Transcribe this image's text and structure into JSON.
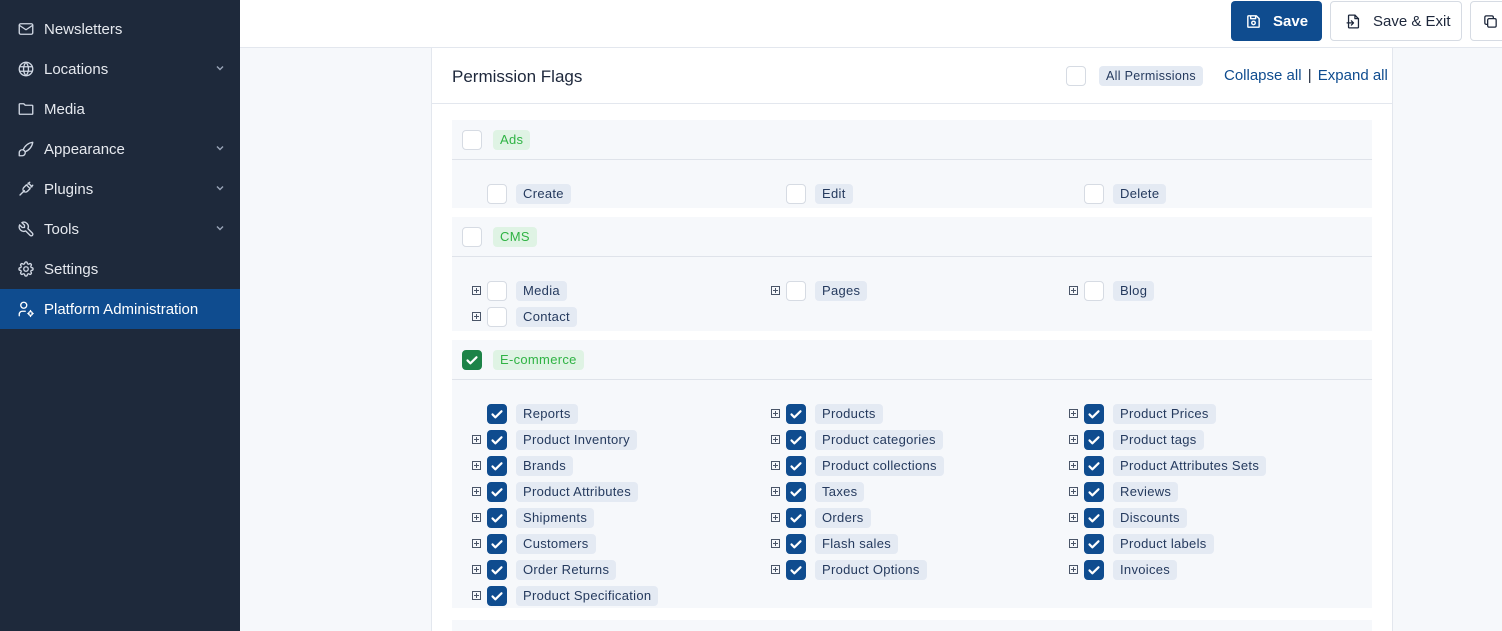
{
  "sidebar": {
    "items": [
      {
        "label": "Newsletters",
        "icon": "mail-icon",
        "has_chevron": false
      },
      {
        "label": "Locations",
        "icon": "globe-icon",
        "has_chevron": true
      },
      {
        "label": "Media",
        "icon": "folder-icon",
        "has_chevron": false
      },
      {
        "label": "Appearance",
        "icon": "brush-icon",
        "has_chevron": true
      },
      {
        "label": "Plugins",
        "icon": "plug-icon",
        "has_chevron": true
      },
      {
        "label": "Tools",
        "icon": "tool-icon",
        "has_chevron": true
      },
      {
        "label": "Settings",
        "icon": "gear-icon",
        "has_chevron": false
      },
      {
        "label": "Platform Administration",
        "icon": "user-cog-icon",
        "has_chevron": false,
        "active": true
      }
    ]
  },
  "toolbar": {
    "save_label": "Save",
    "save_exit_label": "Save & Exit"
  },
  "card": {
    "title": "Permission Flags",
    "all_permissions_label": "All Permissions",
    "all_permissions_checked": false,
    "collapse_all": "Collapse all",
    "separator": "|",
    "expand_all": "Expand all"
  },
  "groups": [
    {
      "name": "Ads",
      "checked": false,
      "items": [
        {
          "label": "Create",
          "checked": false,
          "expandable": false
        },
        {
          "label": "Edit",
          "checked": false,
          "expandable": false
        },
        {
          "label": "Delete",
          "checked": false,
          "expandable": false
        }
      ]
    },
    {
      "name": "CMS",
      "checked": false,
      "items": [
        {
          "label": "Media",
          "checked": false,
          "expandable": true
        },
        {
          "label": "Pages",
          "checked": false,
          "expandable": true
        },
        {
          "label": "Blog",
          "checked": false,
          "expandable": true
        },
        {
          "label": "Contact",
          "checked": false,
          "expandable": true
        }
      ]
    },
    {
      "name": "E-commerce",
      "checked": true,
      "items": [
        {
          "label": "Reports",
          "checked": true,
          "expandable": false
        },
        {
          "label": "Products",
          "checked": true,
          "expandable": true
        },
        {
          "label": "Product Prices",
          "checked": true,
          "expandable": true
        },
        {
          "label": "Product Inventory",
          "checked": true,
          "expandable": true
        },
        {
          "label": "Product categories",
          "checked": true,
          "expandable": true
        },
        {
          "label": "Product tags",
          "checked": true,
          "expandable": true
        },
        {
          "label": "Brands",
          "checked": true,
          "expandable": true
        },
        {
          "label": "Product collections",
          "checked": true,
          "expandable": true
        },
        {
          "label": "Product Attributes Sets",
          "checked": true,
          "expandable": true
        },
        {
          "label": "Product Attributes",
          "checked": true,
          "expandable": true
        },
        {
          "label": "Taxes",
          "checked": true,
          "expandable": true
        },
        {
          "label": "Reviews",
          "checked": true,
          "expandable": true
        },
        {
          "label": "Shipments",
          "checked": true,
          "expandable": true
        },
        {
          "label": "Orders",
          "checked": true,
          "expandable": true
        },
        {
          "label": "Discounts",
          "checked": true,
          "expandable": true
        },
        {
          "label": "Customers",
          "checked": true,
          "expandable": true
        },
        {
          "label": "Flash sales",
          "checked": true,
          "expandable": true
        },
        {
          "label": "Product labels",
          "checked": true,
          "expandable": true
        },
        {
          "label": "Order Returns",
          "checked": true,
          "expandable": true
        },
        {
          "label": "Product Options",
          "checked": true,
          "expandable": true
        },
        {
          "label": "Invoices",
          "checked": true,
          "expandable": true
        },
        {
          "label": "Product Specification",
          "checked": true,
          "expandable": true
        }
      ]
    }
  ],
  "colors": {
    "sidebar_bg": "#1e293b",
    "accent": "#0f4c8f",
    "group_checked": "#1d8348",
    "group_badge_text": "#2fb344"
  }
}
